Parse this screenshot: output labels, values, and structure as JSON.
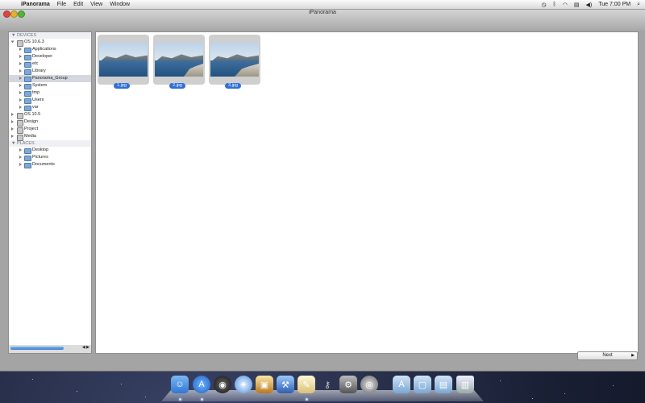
{
  "menubar": {
    "app_name": "iPanorama",
    "items": [
      "File",
      "Edit",
      "View",
      "Window"
    ],
    "clock": "Tue 7:00 PM"
  },
  "window": {
    "title": "iPanorama"
  },
  "sidebar": {
    "devices_header": "DEVICES",
    "places_header": "PLACES",
    "devices": [
      {
        "label": "OS 10.6.3"
      },
      {
        "label": "Applications"
      },
      {
        "label": "Developer"
      },
      {
        "label": "etc"
      },
      {
        "label": "Library"
      },
      {
        "label": "Panorama_Group"
      },
      {
        "label": "System"
      },
      {
        "label": "tmp"
      },
      {
        "label": "Users"
      },
      {
        "label": "var"
      },
      {
        "label": "OS 10.5"
      },
      {
        "label": "Design"
      },
      {
        "label": "Project"
      },
      {
        "label": "Media"
      }
    ],
    "places": [
      {
        "label": "Desktop"
      },
      {
        "label": "Pictures"
      },
      {
        "label": "Documents"
      }
    ],
    "selected": "Panorama_Group"
  },
  "images": [
    {
      "name": "1.jpg"
    },
    {
      "name": "2.jpg"
    },
    {
      "name": "3.jpg"
    }
  ],
  "buttons": {
    "next_label": "Next"
  },
  "dock": {
    "icons": [
      "finder-icon",
      "app-store-icon",
      "dashboard-icon",
      "safari-icon",
      "preview-icon",
      "xcode-icon",
      "text-editor-icon",
      "keychain-icon",
      "system-preferences-icon",
      "disk-utility-icon",
      "applications-folder-icon",
      "documents-folder-icon",
      "downloads-folder-icon",
      "trash-icon"
    ]
  }
}
